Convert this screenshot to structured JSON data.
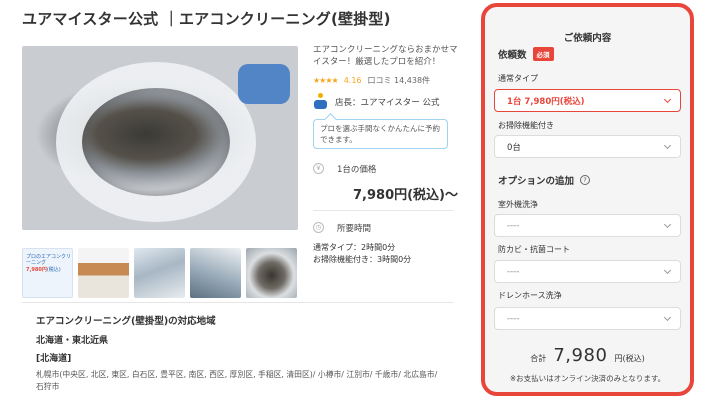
{
  "header": {
    "title": "ユアマイスター公式 ｜エアコンクリーニング(壁掛型)"
  },
  "gallery": {
    "thumb1_title": "プロのエアコンクリーニング",
    "thumb1_price": "7,980円",
    "thumb1_sub": "(税込)"
  },
  "intro": {
    "text": "エアコンクリーニングならおまかせマイスター！厳選したプロを紹介！"
  },
  "rating": {
    "stars": "★★★★",
    "score": "4.16",
    "reviews_label": "口コミ",
    "reviews_count": "14,438件"
  },
  "shop": {
    "label": "店長：ユアマイスター 公式",
    "bubble": "プロを選ぶ手間なくかんたんに予約できます。"
  },
  "price": {
    "label": "1台の価格",
    "value": "7,980円(税込)〜"
  },
  "duration": {
    "label": "所要時間",
    "line1": "通常タイプ：2時間0分",
    "line2": "お掃除機能付き：3時間0分"
  },
  "area": {
    "title": "エアコンクリーニング(壁掛型)の対応地域",
    "region": "北海道・東北近県",
    "subregion": "[北海道]",
    "cities": "札幌市(中央区, 北区, 東区, 白石区, 豊平区, 南区, 西区, 厚別区, 手稲区, 清田区)/ 小樽市/ 江別市/ 千歳市/ 北広島市/ 石狩市"
  },
  "order_panel": {
    "title": "ご依頼内容",
    "quantity_label": "依頼数",
    "required_badge": "必須",
    "normal_type_label": "通常タイプ",
    "normal_type_value": "1台 7,980円(税込)",
    "cleaning_func_label": "お掃除機能付き",
    "cleaning_func_value": "0台",
    "options_label": "オプションの追加",
    "options_help": "?",
    "outdoor_label": "室外機洗浄",
    "outdoor_value": "----",
    "mold_label": "防カビ・抗菌コート",
    "mold_value": "----",
    "drain_label": "ドレンホース洗浄",
    "drain_value": "----",
    "total_label": "合計",
    "total_value": "7,980",
    "total_unit": "円(税込)",
    "note": "※お支払いはオンライン決済のみとなります。"
  },
  "colors": {
    "accent": "#e8463b",
    "star": "#f5a623",
    "bubble_border": "#9ed2ef"
  }
}
